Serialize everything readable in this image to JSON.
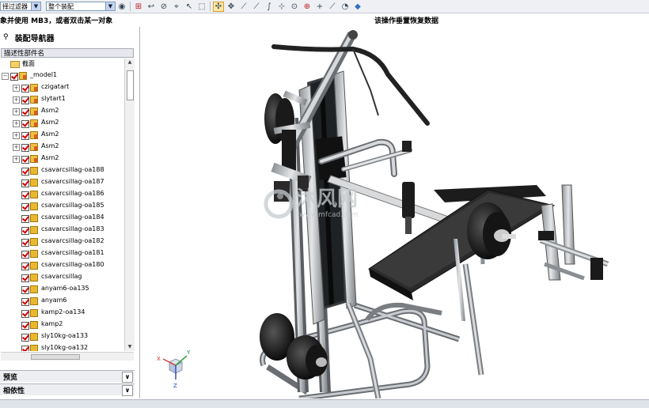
{
  "toolbar": {
    "filter_label": "择过滤器",
    "scope_label": "整个装配"
  },
  "cue": {
    "left": "象并使用 MB3，或者双击某一对象",
    "right": "该操作垂置恢复数据"
  },
  "navigator": {
    "title": "装配导航器",
    "column_header": "描述性部件名",
    "items": [
      {
        "label": "截面",
        "type": "folder",
        "checked": false,
        "expandable": false
      },
      {
        "label": "_model1",
        "type": "assembly",
        "checked": true,
        "expandable": true
      },
      {
        "label": "czigatart",
        "type": "assembly",
        "checked": true,
        "expandable": true
      },
      {
        "label": "slytart1",
        "type": "assembly",
        "checked": true,
        "expandable": true
      },
      {
        "label": "Asm2",
        "type": "assembly",
        "checked": true,
        "expandable": true
      },
      {
        "label": "Asm2",
        "type": "assembly",
        "checked": true,
        "expandable": true
      },
      {
        "label": "Asm2",
        "type": "assembly",
        "checked": true,
        "expandable": true
      },
      {
        "label": "Asm2",
        "type": "assembly",
        "checked": true,
        "expandable": true
      },
      {
        "label": "Asm2",
        "type": "assembly",
        "checked": true,
        "expandable": true
      },
      {
        "label": "csavarcsillag-oa188",
        "type": "part",
        "checked": true,
        "expandable": false
      },
      {
        "label": "csavarcsillag-oa187",
        "type": "part",
        "checked": true,
        "expandable": false
      },
      {
        "label": "csavarcsillag-oa186",
        "type": "part",
        "checked": true,
        "expandable": false
      },
      {
        "label": "csavarcsillag-oa185",
        "type": "part",
        "checked": true,
        "expandable": false
      },
      {
        "label": "csavarcsillag-oa184",
        "type": "part",
        "checked": true,
        "expandable": false
      },
      {
        "label": "csavarcsillag-oa183",
        "type": "part",
        "checked": true,
        "expandable": false
      },
      {
        "label": "csavarcsillag-oa182",
        "type": "part",
        "checked": true,
        "expandable": false
      },
      {
        "label": "csavarcsillag-oa181",
        "type": "part",
        "checked": true,
        "expandable": false
      },
      {
        "label": "csavarcsillag-oa180",
        "type": "part",
        "checked": true,
        "expandable": false
      },
      {
        "label": "csavarcsillag",
        "type": "part",
        "checked": true,
        "expandable": false
      },
      {
        "label": "anyam6-oa135",
        "type": "part",
        "checked": true,
        "expandable": false
      },
      {
        "label": "anyam6",
        "type": "part",
        "checked": true,
        "expandable": false
      },
      {
        "label": "kamp2-oa134",
        "type": "part",
        "checked": true,
        "expandable": false
      },
      {
        "label": "kamp2",
        "type": "part",
        "checked": true,
        "expandable": false
      },
      {
        "label": "sly10kg-oa133",
        "type": "part",
        "checked": true,
        "expandable": false
      },
      {
        "label": "sly10kg-oa132",
        "type": "part",
        "checked": true,
        "expandable": false
      }
    ]
  },
  "panels": {
    "preview": "预览",
    "dependencies": "相依性"
  },
  "watermark": {
    "cn": "沐风网",
    "url": "www.mfcad.com"
  },
  "triad": {
    "x": "X",
    "y": "Y",
    "z": "Z"
  },
  "colors": {
    "check": "#d00000",
    "frame": "#b8bcc0",
    "plate": "#1c1c1c",
    "pad": "#333333",
    "watermark": "#c8ccd0"
  }
}
